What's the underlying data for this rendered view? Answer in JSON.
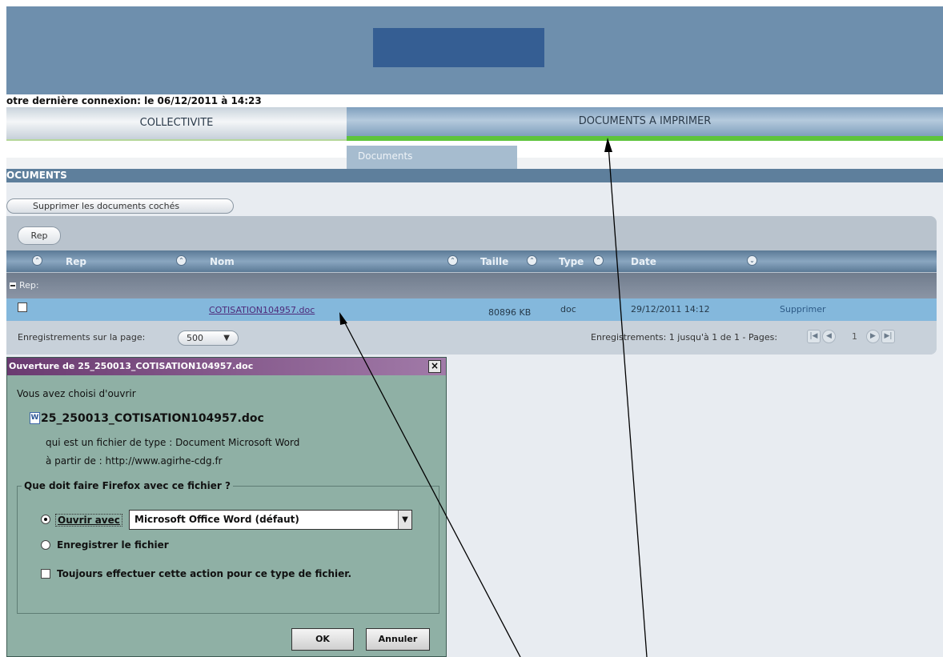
{
  "header": {
    "last_login": "otre dernière connexion: le 06/12/2011 à 14:23"
  },
  "tabs": [
    {
      "label": "COLLECTIVITE"
    },
    {
      "label": "DOCUMENTS A IMPRIMER"
    }
  ],
  "subtabs": [
    {
      "label": "Documents"
    }
  ],
  "section": {
    "title": "OCUMENTS"
  },
  "toolbar": {
    "delete_checked_label": "Supprimer les documents cochés",
    "rep_button_label": "Rep"
  },
  "grid": {
    "columns": [
      {
        "label": "Rep"
      },
      {
        "label": "Nom"
      },
      {
        "label": "Taille"
      },
      {
        "label": "Type"
      },
      {
        "label": "Date"
      }
    ],
    "group_label": "Rep:",
    "rows": [
      {
        "nom": "COTISATION104957.doc",
        "taille": "80896 KB",
        "type": "doc",
        "date": "29/12/2011 14:12",
        "action": "Supprimer"
      }
    ],
    "pager": {
      "per_page_label": "Enregistrements sur la page:",
      "per_page_value": "500",
      "records_label": "Enregistrements: 1 jusqu'à 1 de 1 - Pages:",
      "current_page": "1"
    }
  },
  "dialog": {
    "title": "Ouverture de 25_250013_COTISATION104957.doc",
    "intro": "Vous avez choisi d'ouvrir",
    "filename": "25_250013_COTISATION104957.doc",
    "file_type_line": "qui est un fichier de type :  Document Microsoft Word",
    "from_line": "à partir de :  http://www.agirhe-cdg.fr",
    "question": "Que doit faire Firefox avec ce fichier ?",
    "open_with_label": "Ouvrir avec",
    "open_with_value": "Microsoft Office Word (défaut)",
    "save_label": "Enregistrer le fichier",
    "always_label": "Toujours effectuer cette action pour ce type de fichier.",
    "ok_label": "OK",
    "cancel_label": "Annuler"
  },
  "colors": {
    "header_band": "#6e8fad",
    "header_logo": "#355e93",
    "active_tab_underline": "#5ec43c",
    "selected_row": "#84b8dc",
    "dialog_background": "#8fb0a5",
    "dialog_title": "#6a3a70"
  },
  "icons": {
    "sort": "sort-icon",
    "word_document": "word-document-icon",
    "close": "close-icon",
    "dropdown": "chevron-down-icon",
    "pager": [
      "first-page-icon",
      "previous-page-icon",
      "next-page-icon",
      "last-page-icon"
    ]
  }
}
